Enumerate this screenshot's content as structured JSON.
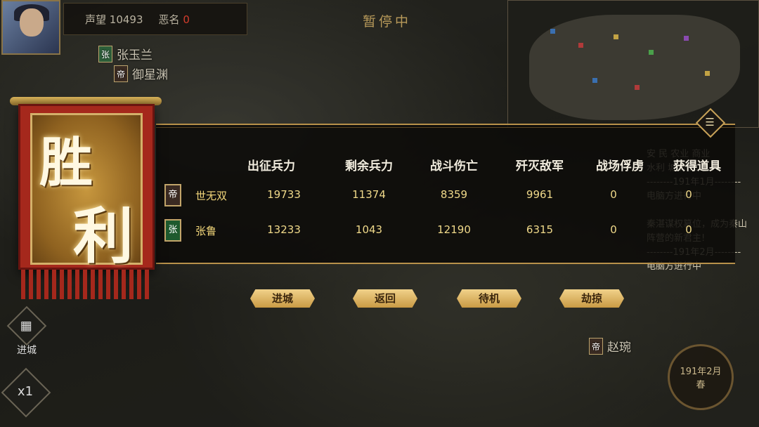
{
  "status": {
    "prestige_label": "声望",
    "prestige_value": "10493",
    "infamy_label": "恶名",
    "infamy_value": "0"
  },
  "paused_text": "暂停中",
  "background_units": [
    {
      "flag": "张",
      "name": "张玉兰"
    },
    {
      "flag": "帝",
      "name": "御星渊"
    },
    {
      "flag": "帝",
      "name": "赵琬"
    }
  ],
  "left_controls": {
    "enter_city_label": "进城",
    "speed_label": "x1"
  },
  "date_badge": {
    "date": "191年2月",
    "season": "春"
  },
  "event_log": {
    "lines": [
      "安  民  农业  商业",
      "水利  城防  人口",
      "--------191年1月--------",
      "电脑方进行中",
      "秦湛谋权篡位，成为秦山阵营的新君主!",
      "--------191年2月--------",
      "电脑方进行中"
    ],
    "highlight_name": "秦湛",
    "highlight_faction": "秦山"
  },
  "banner": {
    "text_top": "胜",
    "text_bottom": "利"
  },
  "results": {
    "headers": [
      "出征兵力",
      "剩余兵力",
      "战斗伤亡",
      "歼灭敌军",
      "战场俘虏",
      "获得道具"
    ],
    "rows": [
      {
        "flag": "帝",
        "name": "世无双",
        "values": [
          "19733",
          "11374",
          "8359",
          "9961",
          "0",
          "0"
        ]
      },
      {
        "flag": "张",
        "name": "张鲁",
        "values": [
          "13233",
          "1043",
          "12190",
          "6315",
          "0",
          "0"
        ]
      }
    ]
  },
  "actions": {
    "enter_city": "进城",
    "return": "返回",
    "standby": "待机",
    "plunder": "劫掠"
  },
  "colors": {
    "accent_gold": "#c99a44",
    "banner_red": "#a5281c",
    "infamy_red": "#d23c2c"
  }
}
